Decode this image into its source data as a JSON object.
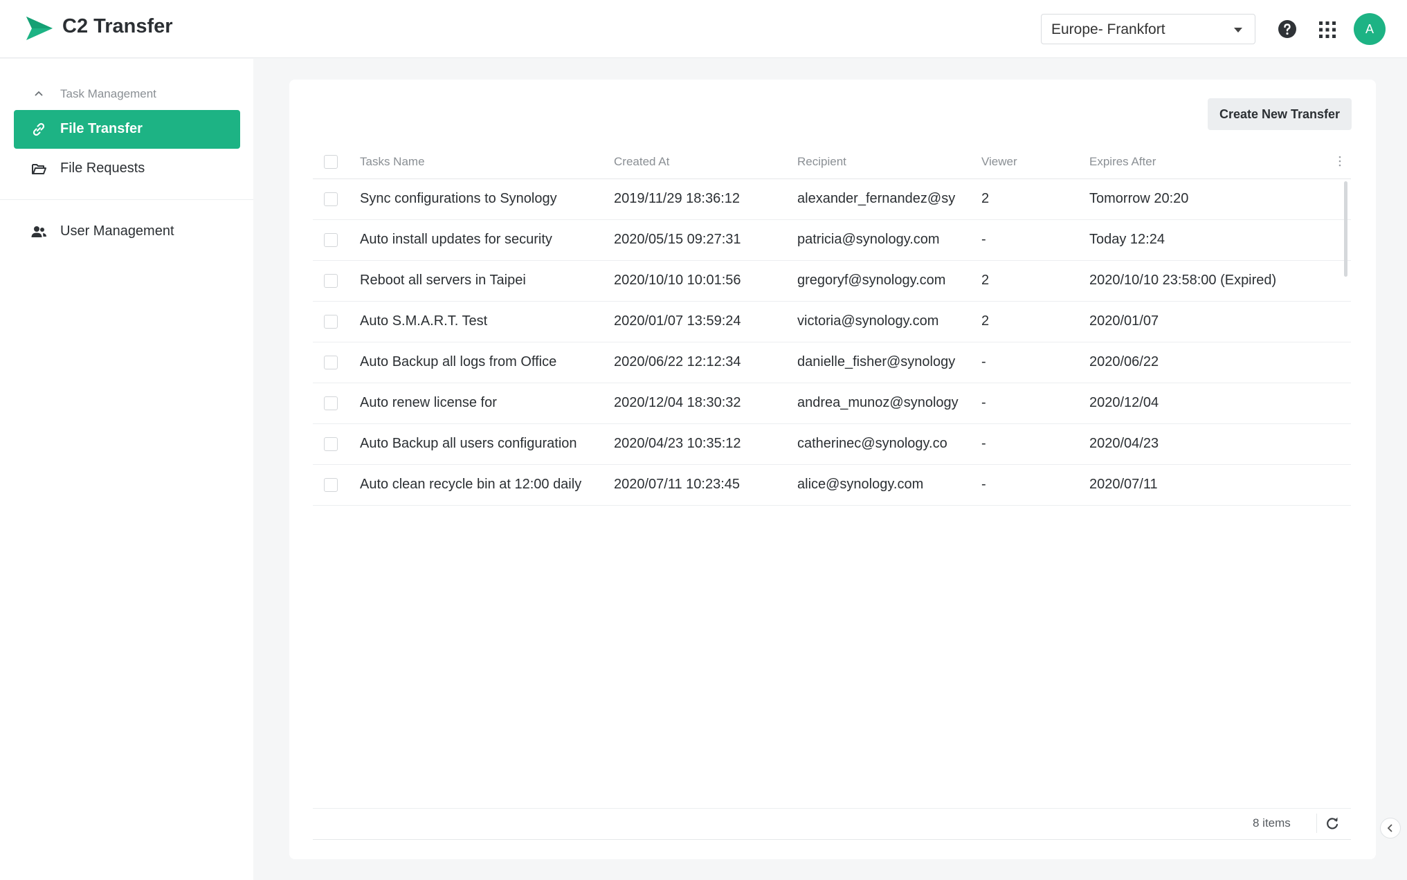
{
  "header": {
    "app_title": "C2 Transfer",
    "region": "Europe- Frankfort",
    "avatar_initial": "A",
    "brand_color": "#1db384"
  },
  "sidebar": {
    "section_title": "Task Management",
    "items": [
      {
        "label": "File Transfer",
        "icon": "link-icon",
        "active": true
      },
      {
        "label": "File Requests",
        "icon": "folder-open-icon",
        "active": false
      },
      {
        "label": "User Management",
        "icon": "users-icon",
        "active": false
      }
    ]
  },
  "main": {
    "create_button": "Create New Transfer",
    "columns": [
      "Tasks Name",
      "Created At",
      "Recipient",
      "Viewer",
      "Expires After"
    ],
    "rows": [
      {
        "name": "Sync configurations to Synology",
        "created": "2019/11/29 18:36:12",
        "recipient": "alexander_fernandez@sy",
        "viewer": "2",
        "expires": "Tomorrow 20:20"
      },
      {
        "name": "Auto install updates for security",
        "created": "2020/05/15 09:27:31",
        "recipient": "patricia@synology.com",
        "viewer": "-",
        "expires": "Today 12:24"
      },
      {
        "name": "Reboot all servers in Taipei",
        "created": "2020/10/10 10:01:56",
        "recipient": "gregoryf@synology.com",
        "viewer": "2",
        "expires": "2020/10/10 23:58:00 (Expired)"
      },
      {
        "name": "Auto S.M.A.R.T. Test",
        "created": "2020/01/07 13:59:24",
        "recipient": "victoria@synology.com",
        "viewer": "2",
        "expires": "2020/01/07"
      },
      {
        "name": "Auto Backup all logs from Office",
        "created": "2020/06/22 12:12:34",
        "recipient": "danielle_fisher@synology",
        "viewer": "-",
        "expires": "2020/06/22"
      },
      {
        "name": "Auto renew license for",
        "created": "2020/12/04 18:30:32",
        "recipient": "andrea_munoz@synology",
        "viewer": "-",
        "expires": "2020/12/04"
      },
      {
        "name": "Auto Backup all users configuration",
        "created": "2020/04/23 10:35:12",
        "recipient": "catherinec@synology.co",
        "viewer": "-",
        "expires": "2020/04/23"
      },
      {
        "name": "Auto clean recycle bin at 12:00 daily",
        "created": "2020/07/11 10:23:45",
        "recipient": "alice@synology.com",
        "viewer": "-",
        "expires": "2020/07/11"
      }
    ],
    "item_count": "8 items"
  }
}
